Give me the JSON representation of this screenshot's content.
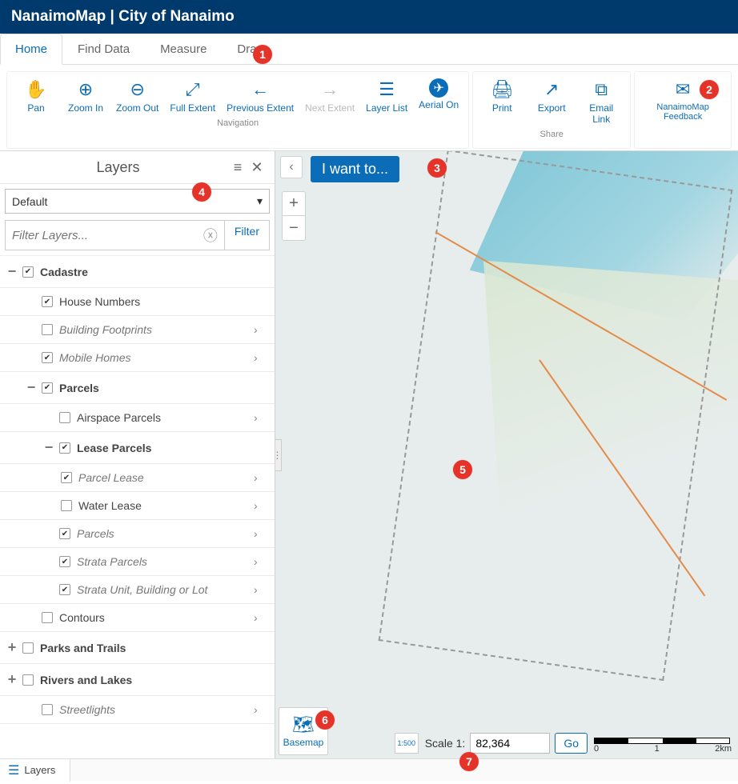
{
  "app_title": "NanaimoMap | City of Nanaimo",
  "tabs": {
    "home": "Home",
    "find_data": "Find Data",
    "measure": "Measure",
    "draw": "Draw"
  },
  "ribbon": {
    "navigation": {
      "label": "Navigation",
      "pan": "Pan",
      "zoom_in": "Zoom In",
      "zoom_out": "Zoom Out",
      "full_extent": "Full Extent",
      "previous_extent": "Previous Extent",
      "next_extent": "Next Extent",
      "layer_list": "Layer List",
      "aerial_on": "Aerial On"
    },
    "share": {
      "label": "Share",
      "print": "Print",
      "export": "Export",
      "email_link": "Email Link"
    },
    "feedback": {
      "label": "NanaimoMap Feedback"
    }
  },
  "sidebar": {
    "title": "Layers",
    "theme_selected": "Default",
    "filter_placeholder": "Filter Layers...",
    "filter_button": "Filter"
  },
  "layers": {
    "cadastre": "Cadastre",
    "house_numbers": "House Numbers",
    "building_footprints": "Building Footprints",
    "mobile_homes": "Mobile Homes",
    "parcels_group": "Parcels",
    "airspace_parcels": "Airspace Parcels",
    "lease_parcels": "Lease Parcels",
    "parcel_lease": "Parcel Lease",
    "water_lease": "Water Lease",
    "parcels": "Parcels",
    "strata_parcels": "Strata Parcels",
    "strata_unit": "Strata Unit, Building or Lot",
    "contours": "Contours",
    "parks_trails": "Parks and Trails",
    "rivers_lakes": "Rivers and Lakes",
    "streetlights": "Streetlights"
  },
  "map": {
    "i_want_to": "I want to...",
    "basemap": "Basemap",
    "scale_label": "Scale 1:",
    "scale_value": "82,364",
    "go": "Go",
    "scale_bar": {
      "t0": "0",
      "t1": "1",
      "t2": "2km"
    }
  },
  "footer": {
    "layers_tab": "Layers"
  },
  "badges": {
    "b1": "1",
    "b2": "2",
    "b3": "3",
    "b4": "4",
    "b5": "5",
    "b6": "6",
    "b7": "7"
  }
}
